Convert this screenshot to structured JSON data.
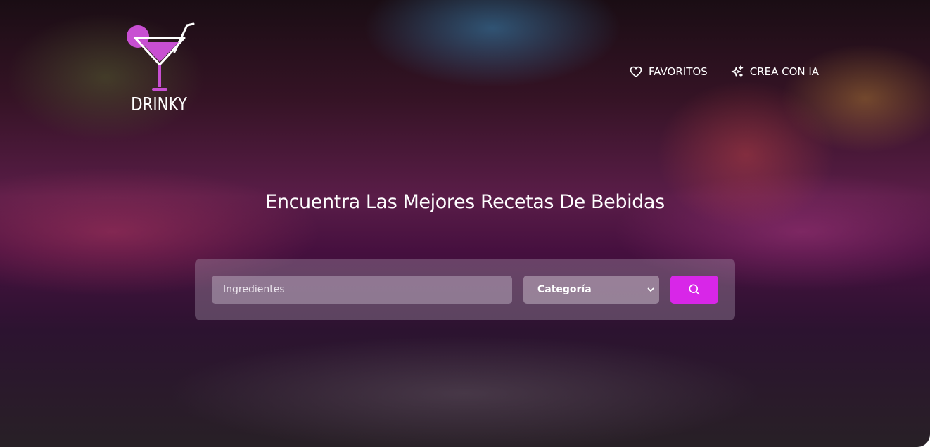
{
  "brand": {
    "name": "DRINKY",
    "accent_color": "#d826e8",
    "logo_icon": "cocktail-glass-icon"
  },
  "nav": {
    "favorites": {
      "label": "FAVORITOS",
      "icon": "heart-icon"
    },
    "create_ai": {
      "label": "CREA CON IA",
      "icon": "sparkles-icon"
    }
  },
  "hero": {
    "title": "Encuentra Las Mejores Recetas De Bebidas"
  },
  "search": {
    "ingredients_placeholder": "Ingredientes",
    "ingredients_value": "",
    "category_selected": "Categoría",
    "button_icon": "search-icon"
  }
}
